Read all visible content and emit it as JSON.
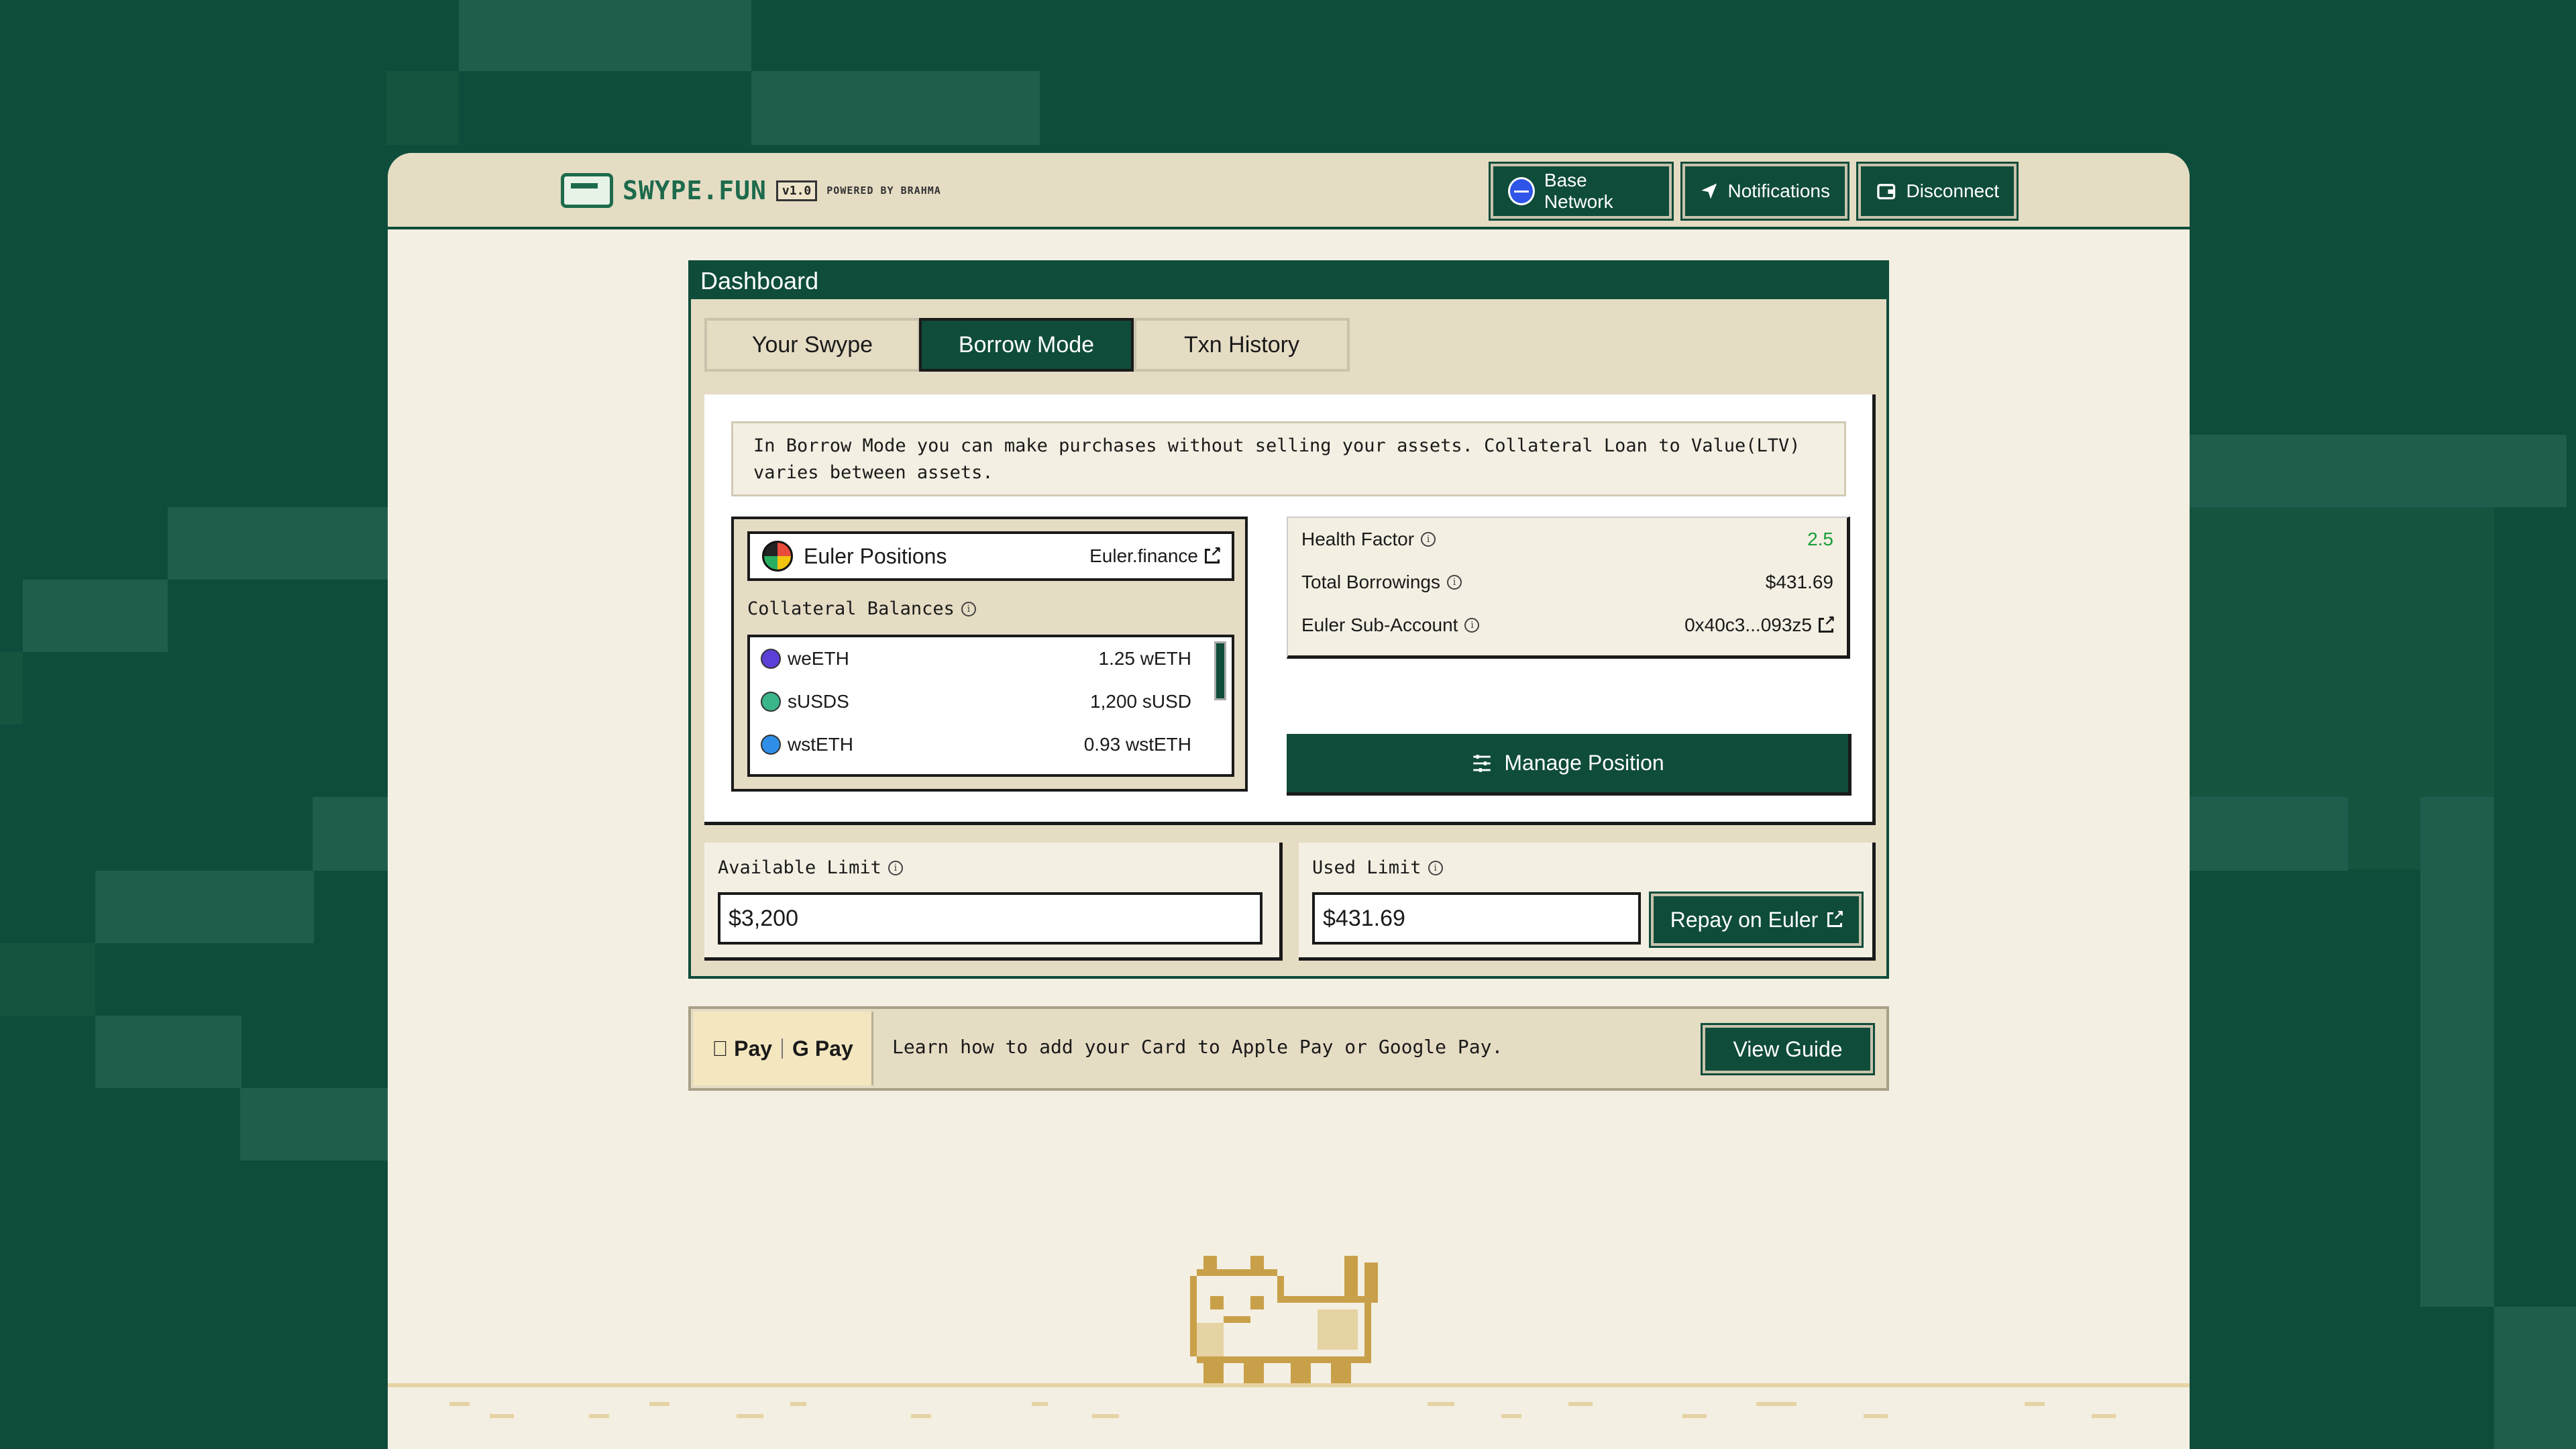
{
  "header": {
    "logo_text": "SWYPE.FUN",
    "version": "v1.0",
    "powered_by": "POWERED BY BRAHMA",
    "network_label": "Base Network",
    "notifications_label": "Notifications",
    "disconnect_label": "Disconnect"
  },
  "dashboard": {
    "title": "Dashboard",
    "tabs": [
      {
        "label": "Your Swype",
        "active": false
      },
      {
        "label": "Borrow Mode",
        "active": true
      },
      {
        "label": "Txn History",
        "active": false
      }
    ],
    "info_text_line1": "In Borrow Mode you can make purchases without selling your assets. Collateral Loan to Value(LTV)",
    "info_text_line2": "varies between assets.",
    "euler": {
      "title": "Euler Positions",
      "link": "Euler.finance",
      "collateral_label": "Collateral Balances",
      "assets": [
        {
          "name": "weETH",
          "amount": "1.25 wETH",
          "color": "#5b3fd6"
        },
        {
          "name": "sUSDS",
          "amount": "1,200 sUSD",
          "color": "#3bb58a"
        },
        {
          "name": "wstETH",
          "amount": "0.93 wstETH",
          "color": "#2f8fe8"
        }
      ]
    },
    "stats": [
      {
        "label": "Health Factor",
        "value": "2.5"
      },
      {
        "label": "Total Borrowings",
        "value": "$431.69"
      },
      {
        "label": "Euler Sub-Account",
        "value": "0x40c3...093z5"
      }
    ],
    "manage_label": "Manage Position",
    "available_limit": {
      "label": "Available Limit",
      "value": "$3,200"
    },
    "used_limit": {
      "label": "Used Limit",
      "value": "$431.69"
    },
    "repay_label": "Repay on Euler"
  },
  "payment": {
    "apple_pay": "Pay",
    "google_pay": "G Pay",
    "text": "Learn how to add your Card to Apple Pay or Google Pay.",
    "guide_label": "View Guide"
  },
  "colors": {
    "background": "#0e4d3b",
    "accent": "#0f4c3a",
    "panel": "#e5dcc4",
    "health_green": "#1a9c3a"
  }
}
